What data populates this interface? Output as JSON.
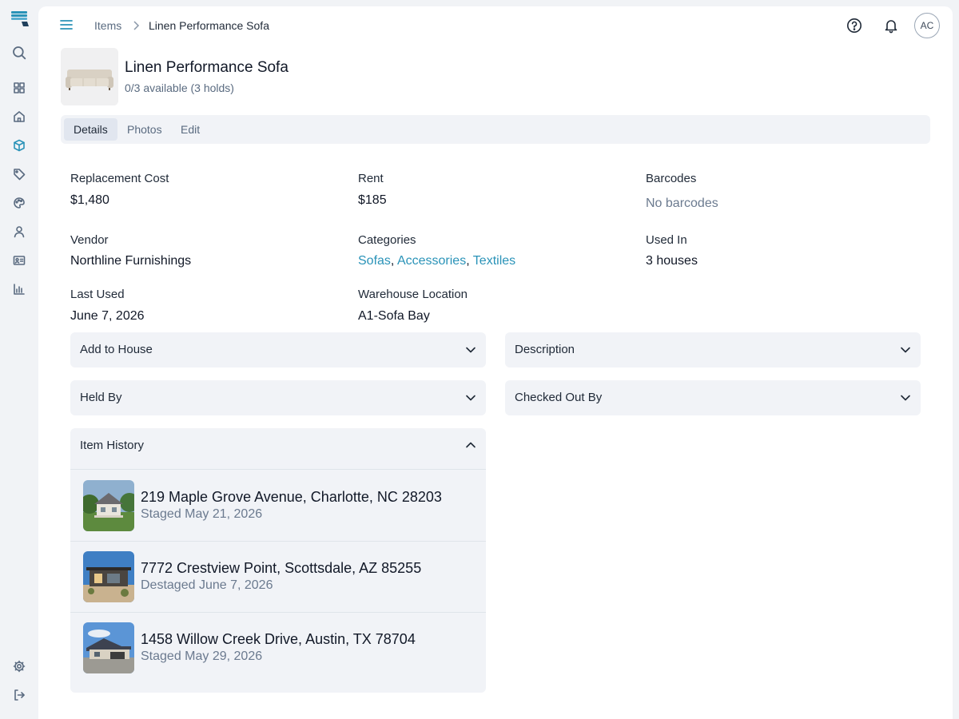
{
  "breadcrumb": {
    "parent": "Items",
    "current": "Linen Performance Sofa"
  },
  "user": {
    "initials": "AC"
  },
  "item": {
    "title": "Linen Performance Sofa",
    "availability": "0/3 available (3 holds)"
  },
  "tabs": [
    {
      "label": "Details",
      "active": true
    },
    {
      "label": "Photos",
      "active": false
    },
    {
      "label": "Edit",
      "active": false
    }
  ],
  "details": {
    "replacement_cost": {
      "label": "Replacement Cost",
      "value": "$1,480"
    },
    "rent": {
      "label": "Rent",
      "value": "$185"
    },
    "barcodes": {
      "label": "Barcodes",
      "value": "No barcodes"
    },
    "vendor": {
      "label": "Vendor",
      "value": "Northline Furnishings"
    },
    "categories": {
      "label": "Categories",
      "items": [
        "Sofas",
        "Accessories",
        "Textiles"
      ],
      "sep": ","
    },
    "used_in": {
      "label": "Used In",
      "value": "3 houses"
    },
    "last_used": {
      "label": "Last Used",
      "value": "June 7, 2026"
    },
    "warehouse": {
      "label": "Warehouse Location",
      "value": "A1-Sofa Bay"
    }
  },
  "accordions": {
    "add_to_house": "Add to House",
    "description": "Description",
    "held_by": "Held By",
    "checked_out_by": "Checked Out By",
    "item_history": "Item History"
  },
  "history": [
    {
      "address": "219 Maple Grove Avenue, Charlotte, NC 28203",
      "status": "Staged May 21, 2026"
    },
    {
      "address": "7772 Crestview Point, Scottsdale, AZ 85255",
      "status": "Destaged June 7, 2026"
    },
    {
      "address": "1458 Willow Creek Drive, Austin, TX 78704",
      "status": "Staged May 29, 2026"
    }
  ],
  "colors": {
    "accent": "#2a93b8",
    "panel": "#f1f3f7",
    "muted": "#6b7a8f"
  },
  "icons": {
    "sidebar": [
      "logo-icon",
      "search-icon",
      "dashboard-icon",
      "home-icon",
      "box-icon",
      "tag-icon",
      "palette-icon",
      "user-icon",
      "id-card-icon",
      "chart-icon",
      "settings-icon",
      "logout-icon"
    ],
    "topbar": [
      "menu-icon",
      "help-icon",
      "bell-icon"
    ]
  }
}
